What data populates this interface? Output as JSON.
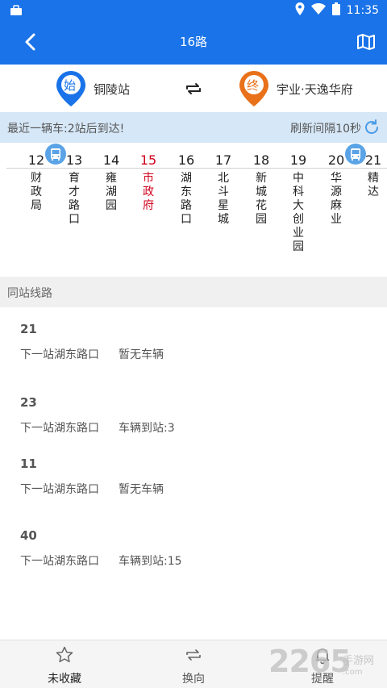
{
  "status_bar": {
    "time": "11:35"
  },
  "app_bar": {
    "title": "16路"
  },
  "route": {
    "start_badge": "始",
    "start_name": "铜陵站",
    "end_badge": "终",
    "end_name": "宇业·天逸华府"
  },
  "info": {
    "message": "最近一辆车:2站后到达!",
    "refresh": "刷新间隔10秒"
  },
  "stations": [
    {
      "num": "12",
      "name": "财政局"
    },
    {
      "num": "13",
      "name": "育才路口"
    },
    {
      "num": "14",
      "name": "雍湖园"
    },
    {
      "num": "15",
      "name": "市政府",
      "current": true
    },
    {
      "num": "16",
      "name": "湖东路口"
    },
    {
      "num": "17",
      "name": "北斗星城"
    },
    {
      "num": "18",
      "name": "新城花园"
    },
    {
      "num": "19",
      "name": "中科大创业园"
    },
    {
      "num": "20",
      "name": "华源麻业"
    },
    {
      "num": "21",
      "name": "精达"
    }
  ],
  "section": {
    "title": "同站线路"
  },
  "lines": [
    {
      "num": "21",
      "next": "下一站湖东路口",
      "status": "暂无车辆"
    },
    {
      "num": "23",
      "next": "下一站湖东路口",
      "status": "车辆到站:3"
    },
    {
      "num": "11",
      "next": "下一站湖东路口",
      "status": "暂无车辆"
    },
    {
      "num": "40",
      "next": "下一站湖东路口",
      "status": "车辆到站:15"
    }
  ],
  "bottom": {
    "favorite": "未收藏",
    "switch": "换向",
    "remind": "提醒"
  },
  "watermark": {
    "big": "2265",
    "small": "手游网",
    "url": ".com"
  },
  "colors": {
    "primary": "#1a73e8",
    "start_pin": "#1a73e8",
    "end_pin": "#e8711a",
    "current_station": "#d0021b"
  }
}
